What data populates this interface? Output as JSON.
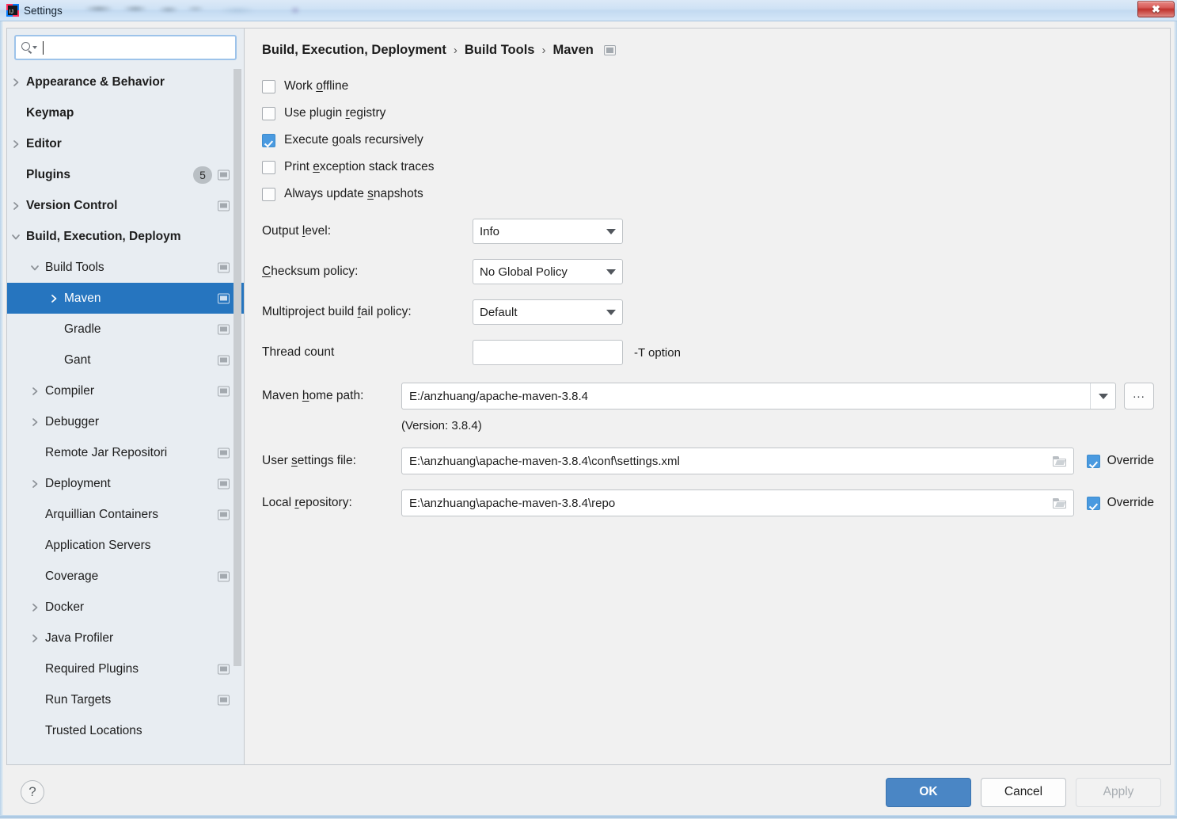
{
  "window": {
    "title": "Settings",
    "close_label": "✖",
    "logo_glyph": "IJ"
  },
  "sidebar": {
    "search": {
      "value": "",
      "placeholder": ""
    },
    "items": [
      {
        "label": "Appearance & Behavior",
        "level": 0,
        "twisty": "collapsed",
        "icon": false,
        "badge": null,
        "selected": false
      },
      {
        "label": "Keymap",
        "level": 0,
        "twisty": "none",
        "icon": false,
        "badge": null,
        "selected": false
      },
      {
        "label": "Editor",
        "level": 0,
        "twisty": "collapsed",
        "icon": false,
        "badge": null,
        "selected": false
      },
      {
        "label": "Plugins",
        "level": 0,
        "twisty": "none",
        "icon": true,
        "badge": "5",
        "selected": false
      },
      {
        "label": "Version Control",
        "level": 0,
        "twisty": "collapsed",
        "icon": true,
        "badge": null,
        "selected": false
      },
      {
        "label": "Build, Execution, Deploym",
        "level": 0,
        "twisty": "expanded",
        "icon": false,
        "badge": null,
        "selected": false
      },
      {
        "label": "Build Tools",
        "level": 1,
        "twisty": "expanded",
        "icon": true,
        "badge": null,
        "selected": false
      },
      {
        "label": "Maven",
        "level": 2,
        "twisty": "collapsed",
        "icon": true,
        "badge": null,
        "selected": true
      },
      {
        "label": "Gradle",
        "level": 2,
        "twisty": "none",
        "icon": true,
        "badge": null,
        "selected": false
      },
      {
        "label": "Gant",
        "level": 2,
        "twisty": "none",
        "icon": true,
        "badge": null,
        "selected": false
      },
      {
        "label": "Compiler",
        "level": 1,
        "twisty": "collapsed",
        "icon": true,
        "badge": null,
        "selected": false
      },
      {
        "label": "Debugger",
        "level": 1,
        "twisty": "collapsed",
        "icon": false,
        "badge": null,
        "selected": false
      },
      {
        "label": "Remote Jar Repositori",
        "level": 1,
        "twisty": "none",
        "icon": true,
        "badge": null,
        "selected": false
      },
      {
        "label": "Deployment",
        "level": 1,
        "twisty": "collapsed",
        "icon": true,
        "badge": null,
        "selected": false
      },
      {
        "label": "Arquillian Containers",
        "level": 1,
        "twisty": "none",
        "icon": true,
        "badge": null,
        "selected": false
      },
      {
        "label": "Application Servers",
        "level": 1,
        "twisty": "none",
        "icon": false,
        "badge": null,
        "selected": false
      },
      {
        "label": "Coverage",
        "level": 1,
        "twisty": "none",
        "icon": true,
        "badge": null,
        "selected": false
      },
      {
        "label": "Docker",
        "level": 1,
        "twisty": "collapsed",
        "icon": false,
        "badge": null,
        "selected": false
      },
      {
        "label": "Java Profiler",
        "level": 1,
        "twisty": "collapsed",
        "icon": false,
        "badge": null,
        "selected": false
      },
      {
        "label": "Required Plugins",
        "level": 1,
        "twisty": "none",
        "icon": true,
        "badge": null,
        "selected": false
      },
      {
        "label": "Run Targets",
        "level": 1,
        "twisty": "none",
        "icon": true,
        "badge": null,
        "selected": false
      },
      {
        "label": "Trusted Locations",
        "level": 1,
        "twisty": "none",
        "icon": false,
        "badge": null,
        "selected": false
      }
    ]
  },
  "panel": {
    "breadcrumb": [
      "Build, Execution, Deployment",
      "Build Tools",
      "Maven"
    ],
    "breadcrumb_separator": "›",
    "checkboxes": [
      {
        "label_before": "Work ",
        "mnemonic": "o",
        "label_after": "ffline",
        "checked": false
      },
      {
        "label_before": "Use plugin ",
        "mnemonic": "r",
        "label_after": "egistry",
        "checked": false
      },
      {
        "label_before": "Execute ",
        "mnemonic": "g",
        "label_after": "oals recursively",
        "checked": true
      },
      {
        "label_before": "Print ",
        "mnemonic": "e",
        "label_after": "xception stack traces",
        "checked": false
      },
      {
        "label_before": "Always update ",
        "mnemonic": "s",
        "label_after": "napshots",
        "checked": false
      }
    ],
    "output_level": {
      "label_before": "Output ",
      "mnemonic": "l",
      "label_after": "evel:",
      "value": "Info"
    },
    "checksum_policy": {
      "label_before": "",
      "mnemonic": "C",
      "label_after": "hecksum policy:",
      "value": "No Global Policy"
    },
    "fail_policy": {
      "label_before": "Multiproject build ",
      "mnemonic": "f",
      "label_after": "ail policy:",
      "value": "Default"
    },
    "thread_count": {
      "label": "Thread count",
      "value": "",
      "hint": "-T option"
    },
    "maven_home": {
      "label_before": "Maven ",
      "mnemonic": "h",
      "label_after": "ome path:",
      "value": "E:/anzhuang/apache-maven-3.8.4",
      "ellipsis_label": "...",
      "version_line": "(Version: 3.8.4)"
    },
    "user_settings": {
      "label_before": "User ",
      "mnemonic": "s",
      "label_after": "ettings file:",
      "value": "E:\\anzhuang\\apache-maven-3.8.4\\conf\\settings.xml",
      "override_label": "Override",
      "override_checked": true
    },
    "local_repository": {
      "label_before": "Local ",
      "mnemonic": "r",
      "label_after": "epository:",
      "value": "E:\\anzhuang\\apache-maven-3.8.4\\repo",
      "override_label": "Override",
      "override_checked": true
    }
  },
  "footer": {
    "help_label": "?",
    "ok_label": "OK",
    "cancel_label": "Cancel",
    "apply_label": "Apply",
    "apply_disabled": true
  },
  "colors": {
    "accent_blue": "#4a86c5",
    "selection_blue": "#2675bf",
    "checkbox_blue": "#4a9ae0",
    "sidebar_bg": "#e8edf2",
    "panel_bg": "#f1f1f1"
  }
}
